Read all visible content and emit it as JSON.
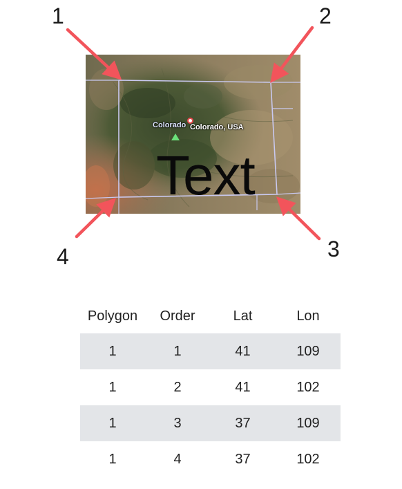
{
  "corner_labels": [
    "1",
    "2",
    "3",
    "4"
  ],
  "map": {
    "overlay_text": "Text",
    "place_label": "Colorado",
    "pin_label": "Colorado, USA",
    "arrow_color": "#f2545b",
    "border_color": "#c9c9f0"
  },
  "table": {
    "headers": [
      "Polygon",
      "Order",
      "Lat",
      "Lon"
    ],
    "rows": [
      [
        "1",
        "1",
        "41",
        "109"
      ],
      [
        "1",
        "2",
        "41",
        "102"
      ],
      [
        "1",
        "3",
        "37",
        "109"
      ],
      [
        "1",
        "4",
        "37",
        "102"
      ]
    ],
    "shade_color": "#e3e5e8"
  }
}
